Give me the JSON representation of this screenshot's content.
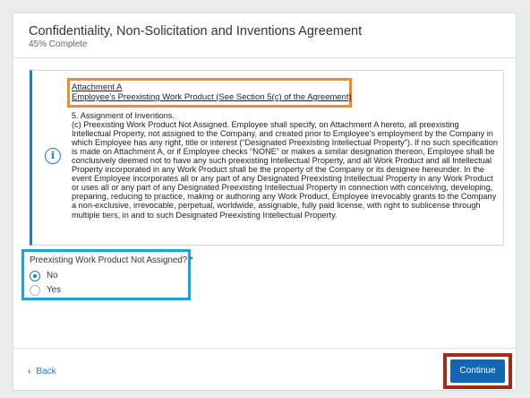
{
  "header": {
    "title": "Confidentiality, Non-Solicitation and Inventions Agreement",
    "progress_text": "45% Complete"
  },
  "notice": {
    "attachment_title": "Attachment A",
    "attachment_subtitle": "Employee’s Preexisting Work Product (See Section 5(c) of the Agreement)",
    "section_heading": "5. Assignment of Inventions.",
    "body": "(c) Preexisting Work Product Not Assigned. Employee shall specify, on Attachment A hereto, all preexisting Intellectual Property, not assigned to the Company, and created prior to Employee’s employment by the Company in which Employee has any right, title or interest (“Designated Preexisting Intellectual Property”). If no such specification is made on Attachment A, or if Employee checks “NONE” or makes a similar designation thereon, Employee shall be conclusively deemed not to have any such preexisting Intellectual Property, and all Work Product and all Intellectual Property incorporated in any Work Product shall be the property of the Company or its designee hereunder. In the event Employee incorporates all or any part of any Designated Preexisting Intellectual Property in any Work Product or uses all or any part of any Designated Preexisting Intellectual Property in connection with conceiving, developing, preparing, reducing to practice, making or authoring any Work Product, Employee irrevocably grants to the Company a non-exclusive, irrevocable, perpetual, worldwide, assignable, fully paid license, with right to sublicense through multiple tiers, in and to such Designated Preexisting Intellectual Property.",
    "icon": "info-circle-icon"
  },
  "question": {
    "label": "Preexisting Work Product Not Assigned? *",
    "options": [
      {
        "label": "No",
        "selected": true
      },
      {
        "label": "Yes",
        "selected": false
      }
    ]
  },
  "footer": {
    "back_label": "Back",
    "back_icon": "chevron-left-icon",
    "continue_label": "Continue"
  },
  "colors": {
    "accent": "#1b7bd2",
    "button": "#1366b4",
    "highlight_attachment": "#f28c21",
    "highlight_question": "#1da1dc",
    "highlight_continue": "#a3291c"
  }
}
